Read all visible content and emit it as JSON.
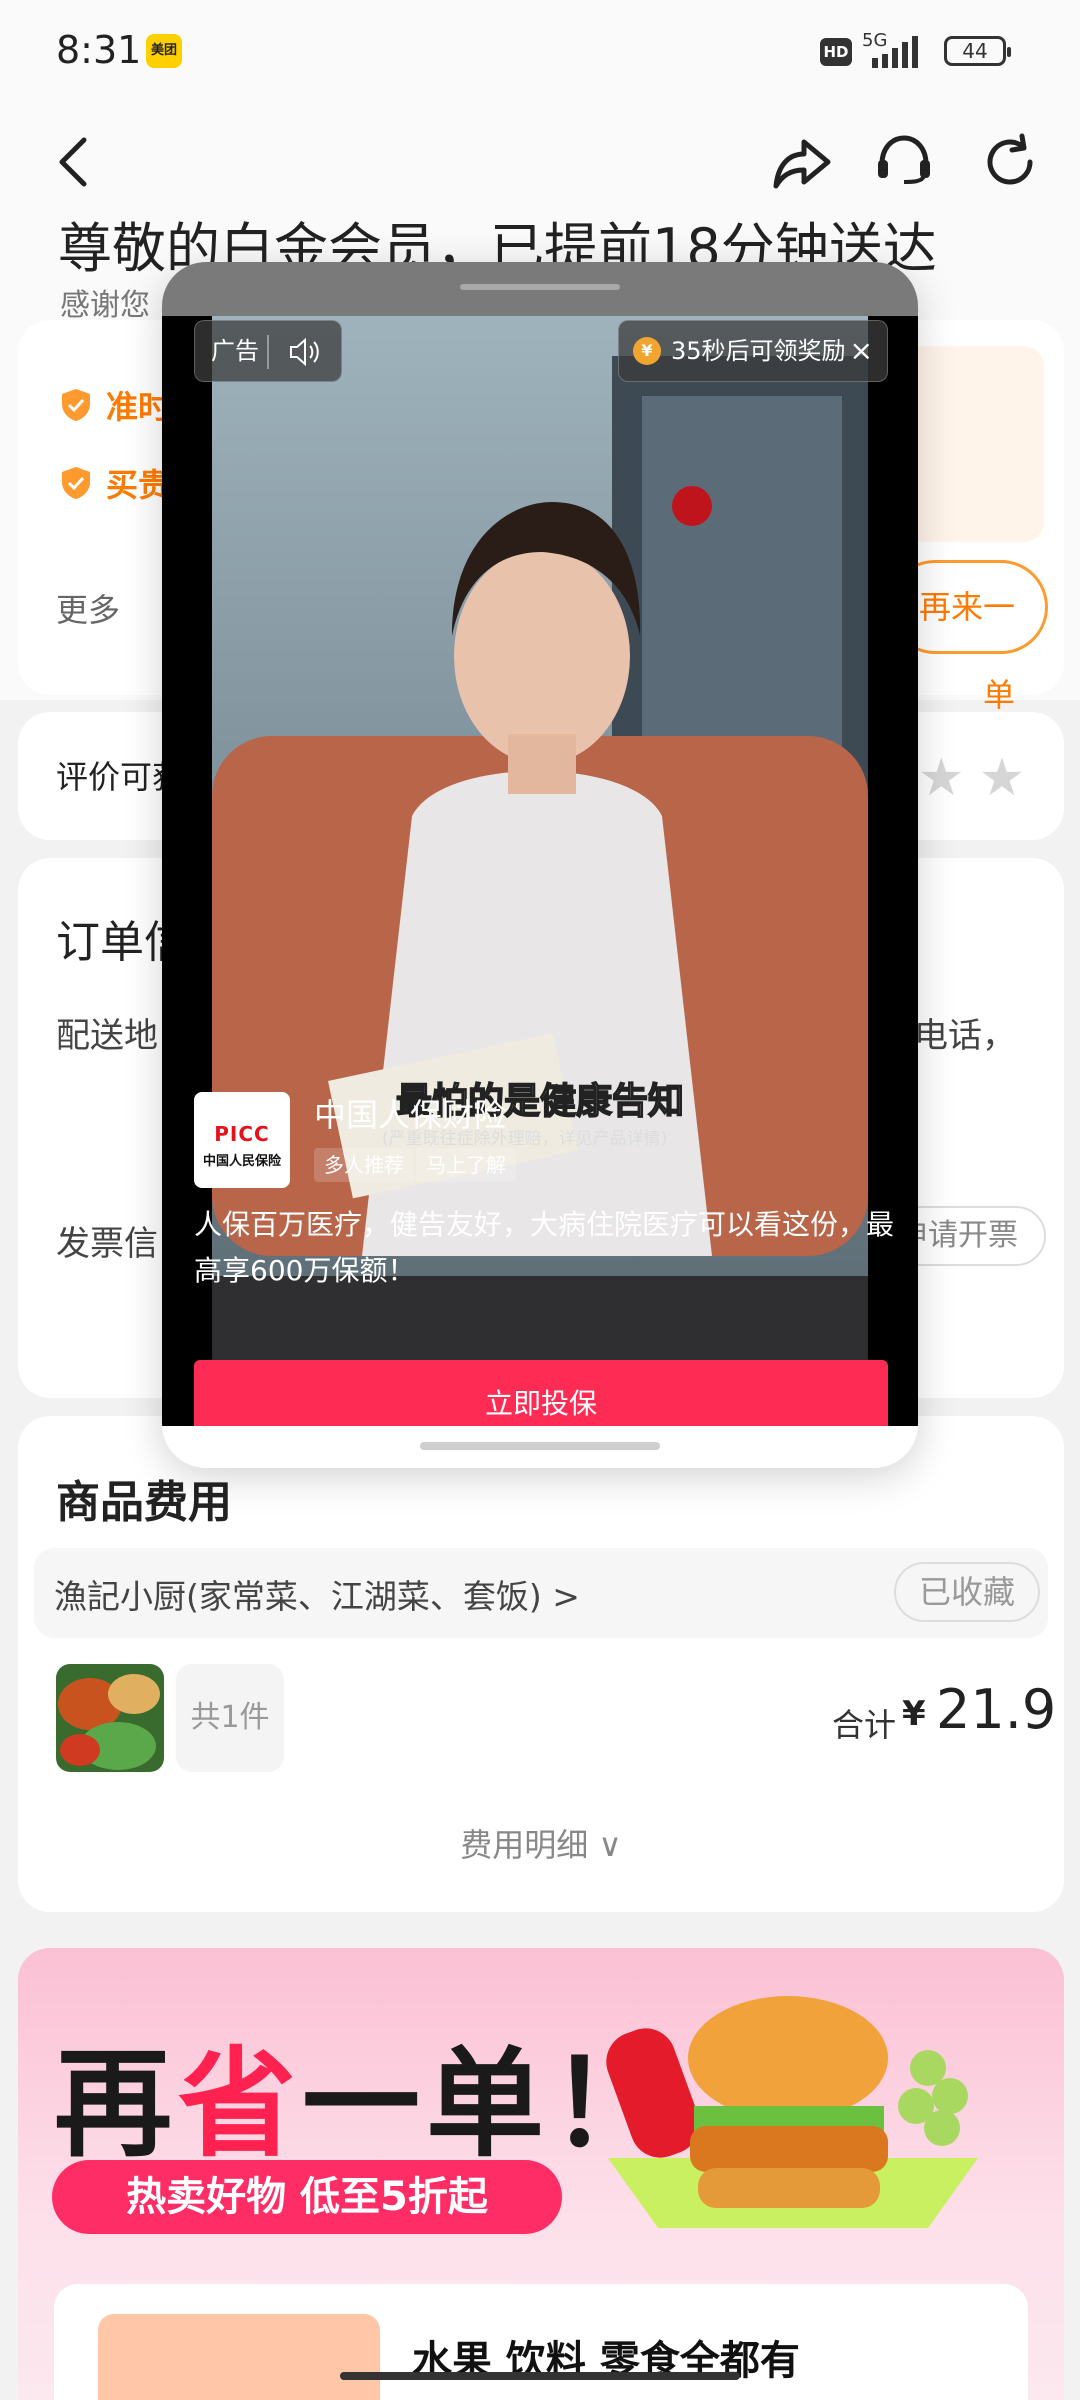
{
  "status_bar": {
    "time": "8:31",
    "app_badge": "美团",
    "hd": "HD",
    "network": "5G",
    "battery": "44"
  },
  "header": {
    "headline": "尊敬的白金会员，已提前18分钟送达",
    "subline": "感谢您"
  },
  "perks": {
    "items": [
      {
        "label": "准时"
      },
      {
        "label": "买贵"
      }
    ],
    "more_label": "更多",
    "reorder_label": "再来一单"
  },
  "review": {
    "label": "评价可获",
    "stars": "★★"
  },
  "order": {
    "title": "订单信",
    "address_label": "配送地",
    "address_right": "电话，",
    "invoice_label": "发票信",
    "invoice_button": "申请开票"
  },
  "fees": {
    "title": "商品费用",
    "shop_name": "漁記小厨(家常菜、江湖菜、套饭) >",
    "fav_button": "已收藏",
    "qty_label": "共1件",
    "total_label": "合计",
    "currency": "¥",
    "total_value": "21.9",
    "detail_label": "费用明细 ∨"
  },
  "banner": {
    "title_a": "再",
    "title_b": "省",
    "title_c": "一单！",
    "pill": "热卖好物 低至5折起",
    "sub_text": "水果 饮料 零食全都有"
  },
  "ad": {
    "tag": "广告",
    "reward_text": "35秒后可领奖励",
    "reward_close": "×",
    "coin": "¥",
    "caption": "最怕的是健康告知",
    "caption_small": "(严重既往症除外理赔，详见产品详情)",
    "logo_line1": "PICC",
    "logo_line2": "中国人民保险",
    "brand": "中国人保财险",
    "chips": [
      "多人推荐",
      "马上了解"
    ],
    "description": "人保百万医疗，健告友好，大病住院医疗可以看这份，最高享600万保额！",
    "cta": "立即投保"
  },
  "colors": {
    "accent_orange": "#ff7a00",
    "ad_cta": "#fe2c55",
    "banner_pink": "#ff2d66"
  }
}
